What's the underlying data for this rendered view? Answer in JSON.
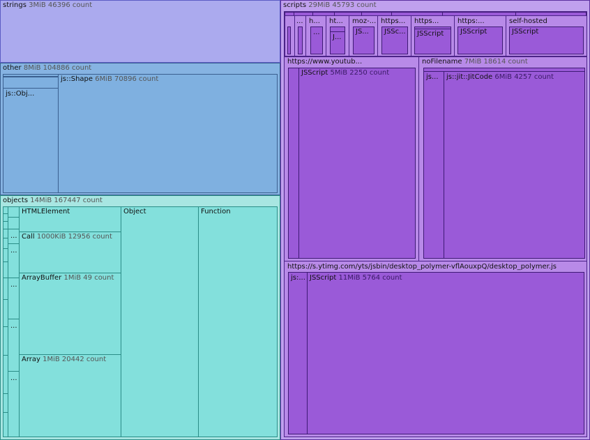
{
  "strings": {
    "name": "strings",
    "meta": "3MiB 46396 count"
  },
  "other": {
    "name": "other",
    "meta": "8MiB 104886 count",
    "shape_name": "js::Shape",
    "shape_meta": "6MiB 70896 count",
    "obj_label": "js::Obj..."
  },
  "objects": {
    "name": "objects",
    "meta": "14MiB 167447 count",
    "html_element": "HTMLElement",
    "call_name": "Call",
    "call_meta": "1000KiB 12956 count",
    "arraybuffer_name": "ArrayBuffer",
    "arraybuffer_meta": "1MiB 49 count",
    "array_name": "Array",
    "array_meta": "1MiB 20442 count",
    "object_label": "Object",
    "function_label": "Function",
    "ellipsis": "..."
  },
  "scripts": {
    "name": "scripts",
    "meta": "29MiB 45793 count",
    "top_cells": [
      {
        "label": "..."
      },
      {
        "label": "h...",
        "inner": "..."
      },
      {
        "label": "ht...",
        "inner": "J..."
      },
      {
        "label": "moz-...",
        "inner": "JS..."
      },
      {
        "label": "https...",
        "inner": "JSSc..."
      },
      {
        "label": "https...",
        "inner": "JSScript"
      },
      {
        "label": "https:...",
        "inner": "JSScript"
      },
      {
        "label": "self-hosted",
        "inner": "JSScript"
      }
    ],
    "youtube": {
      "name": "https://www.youtub...",
      "js_name": "JSScript",
      "js_meta": "5MiB 2250 count"
    },
    "nofilename": {
      "name": "noFilename",
      "meta": "7MiB 18614 count",
      "js_label": "js...",
      "jit_name": "js::jit::JitCode",
      "jit_meta": "6MiB 4257 count"
    },
    "ytimg": {
      "name": "https://s.ytimg.com/yts/jsbin/desktop_polymer-vflAouxpQ/desktop_polymer.js",
      "js_label": "js:...",
      "js_name": "JSScript",
      "js_meta": "11MiB 5764 count"
    }
  }
}
